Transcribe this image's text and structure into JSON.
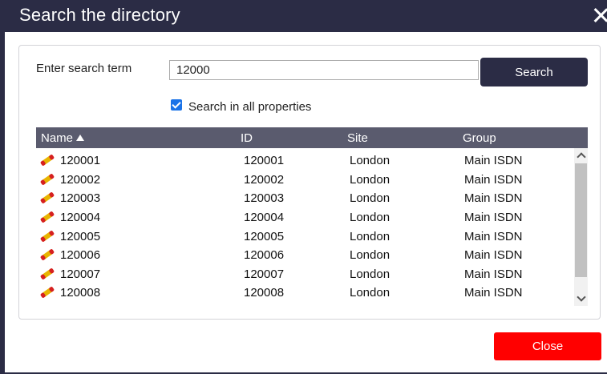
{
  "dialog": {
    "title": "Search the directory"
  },
  "search": {
    "label": "Enter search term",
    "value": "12000",
    "button_label": "Search"
  },
  "options": {
    "all_properties_label": "Search in all properties",
    "all_properties_checked": true
  },
  "table": {
    "columns": [
      "Name",
      "ID",
      "Site",
      "Group"
    ],
    "sort": {
      "column": "Name",
      "direction": "ascending"
    },
    "row_icon": "telephone-icon",
    "rows": [
      [
        "120001",
        "120001",
        "London",
        "Main ISDN"
      ],
      [
        "120002",
        "120002",
        "London",
        "Main ISDN"
      ],
      [
        "120003",
        "120003",
        "London",
        "Main ISDN"
      ],
      [
        "120004",
        "120004",
        "London",
        "Main ISDN"
      ],
      [
        "120005",
        "120005",
        "London",
        "Main ISDN"
      ],
      [
        "120006",
        "120006",
        "London",
        "Main ISDN"
      ],
      [
        "120007",
        "120007",
        "London",
        "Main ISDN"
      ],
      [
        "120008",
        "120008",
        "London",
        "Main ISDN"
      ]
    ]
  },
  "footer": {
    "close_label": "Close"
  },
  "colors": {
    "titlebar": "#2b2c45",
    "header": "#5a5b6e",
    "close_button": "#ff0000",
    "checkbox": "#1a73e8"
  }
}
